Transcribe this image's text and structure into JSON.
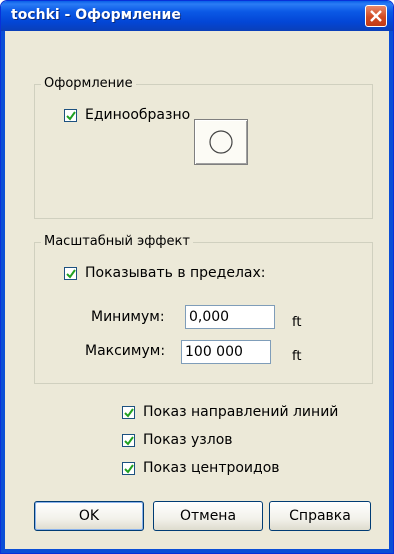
{
  "window": {
    "title": "tochki - Оформление"
  },
  "style_group": {
    "legend": "Оформление",
    "uniform_label": "Единообразно",
    "uniform_checked": true,
    "symbol_icon": "circle-icon"
  },
  "scale_group": {
    "legend": "Масштабный эффект",
    "show_within_label": "Показывать в пределах:",
    "show_within_checked": true,
    "min_label": "Минимум:",
    "min_value": "0,000",
    "min_unit": "ft",
    "max_label": "Максимум:",
    "max_value": "100 000",
    "max_unit": "ft"
  },
  "options": [
    {
      "label": "Показ направлений линий",
      "checked": true
    },
    {
      "label": "Показ узлов",
      "checked": true
    },
    {
      "label": "Показ центроидов",
      "checked": true
    }
  ],
  "buttons": {
    "ok": "OK",
    "cancel": "Отмена",
    "help": "Справка"
  },
  "colors": {
    "titlebar": "#0346d6",
    "close_button": "#d14a22",
    "dialog_bg": "#ece9d8"
  }
}
